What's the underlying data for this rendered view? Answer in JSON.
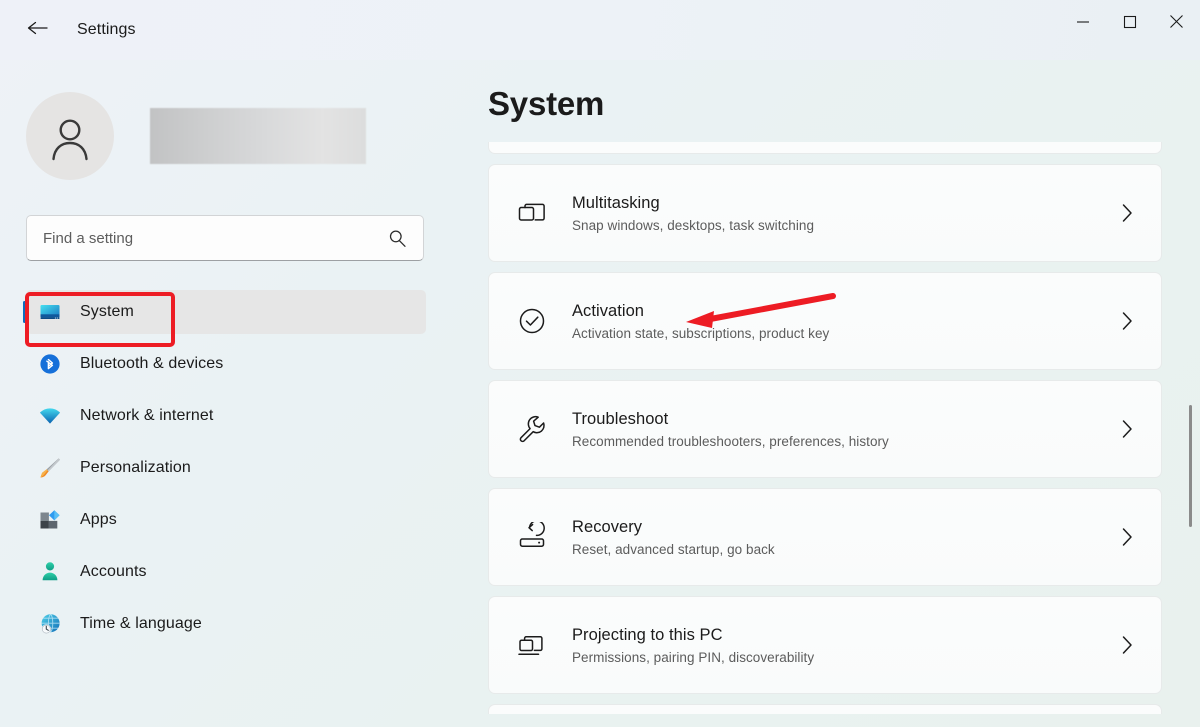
{
  "window": {
    "title": "Settings",
    "back_icon": "back-arrow-icon",
    "minimize_label": "Minimize",
    "maximize_label": "Maximize",
    "close_label": "Close"
  },
  "sidebar": {
    "account_name": "",
    "avatar_icon": "person-icon",
    "search": {
      "placeholder": "Find a setting",
      "value": "",
      "icon": "search-icon"
    },
    "items": [
      {
        "label": "System",
        "icon": "monitor-icon",
        "selected": true
      },
      {
        "label": "Bluetooth & devices",
        "icon": "bluetooth-icon",
        "selected": false
      },
      {
        "label": "Network & internet",
        "icon": "wifi-icon",
        "selected": false
      },
      {
        "label": "Personalization",
        "icon": "paintbrush-icon",
        "selected": false
      },
      {
        "label": "Apps",
        "icon": "apps-squares-icon",
        "selected": false
      },
      {
        "label": "Accounts",
        "icon": "account-person-icon",
        "selected": false
      },
      {
        "label": "Time & language",
        "icon": "globe-clock-icon",
        "selected": false
      }
    ]
  },
  "content": {
    "page_title": "System",
    "cards": [
      {
        "title": "Multitasking",
        "subtitle": "Snap windows, desktops, task switching",
        "icon": "multitasking-windows-icon",
        "chevron": "chevron-right-icon"
      },
      {
        "title": "Activation",
        "subtitle": "Activation state, subscriptions, product key",
        "icon": "check-circle-icon",
        "chevron": "chevron-right-icon"
      },
      {
        "title": "Troubleshoot",
        "subtitle": "Recommended troubleshooters, preferences, history",
        "icon": "wrench-icon",
        "chevron": "chevron-right-icon"
      },
      {
        "title": "Recovery",
        "subtitle": "Reset, advanced startup, go back",
        "icon": "recovery-drive-icon",
        "chevron": "chevron-right-icon"
      },
      {
        "title": "Projecting to this PC",
        "subtitle": "Permissions, pairing PIN, discoverability",
        "icon": "projecting-screens-icon",
        "chevron": "chevron-right-icon"
      }
    ]
  },
  "annotations": {
    "highlight_color": "#ed1c24",
    "arrow_color": "#ed1c24",
    "highlight_target": "System",
    "arrow_target": "Activation"
  },
  "colors": {
    "accent": "#0f6cbd",
    "selected_row": "#e6e6e6",
    "card_background": "#fbfcfc",
    "text_primary": "#1b1b1b",
    "text_secondary": "#5c5c5c"
  }
}
